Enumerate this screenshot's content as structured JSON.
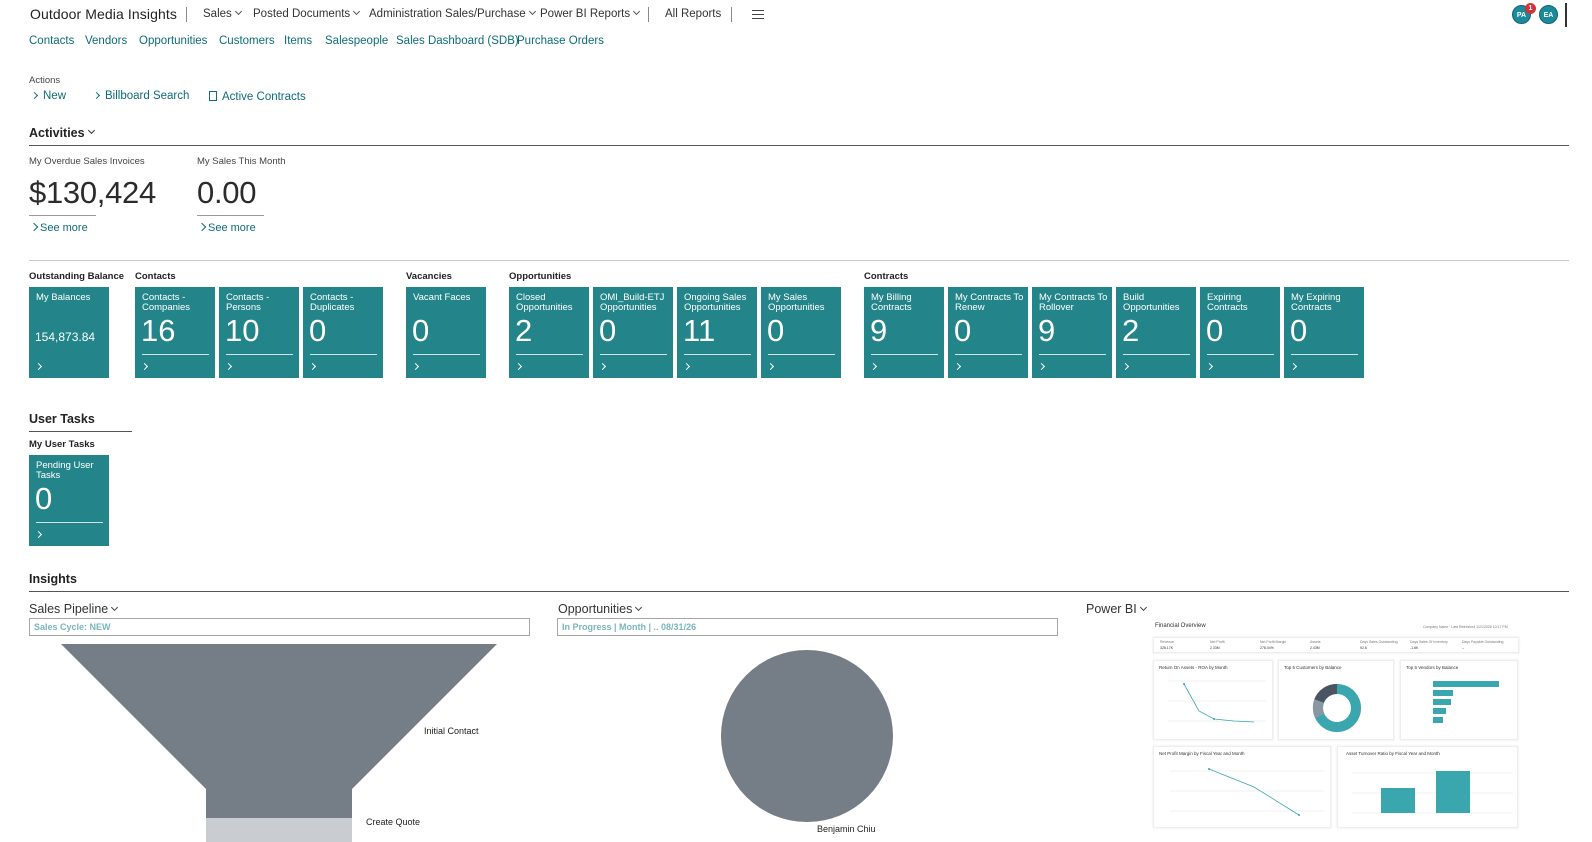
{
  "app_title": "Outdoor Media Insights",
  "topnav": {
    "items": [
      {
        "label": "Sales",
        "dropdown": true
      },
      {
        "label": "Posted Documents",
        "dropdown": true
      },
      {
        "label": "Administration Sales/Purchase",
        "dropdown": true
      },
      {
        "label": "Power BI Reports",
        "dropdown": true
      },
      {
        "label": "All Reports",
        "dropdown": false
      }
    ],
    "menu_icon": "hamburger-icon",
    "avatars": [
      {
        "initials": "PA",
        "badge": "1"
      },
      {
        "initials": "EA"
      }
    ]
  },
  "subnav": [
    "Contacts",
    "Vendors",
    "Opportunities",
    "Customers",
    "Items",
    "Salespeople",
    "Sales Dashboard (SDB)",
    "Purchase Orders"
  ],
  "actions": {
    "label": "Actions",
    "items": [
      {
        "label": "New",
        "icon": "chevron-right-icon"
      },
      {
        "label": "Billboard Search",
        "icon": "chevron-right-icon"
      },
      {
        "label": "Active Contracts",
        "icon": "document-icon"
      }
    ]
  },
  "activities": {
    "title": "Activities",
    "kpis": [
      {
        "label": "My Overdue Sales Invoices",
        "value": "$130,424",
        "link": "See more"
      },
      {
        "label": "My Sales This Month",
        "value": "0.00",
        "link": "See more"
      }
    ],
    "groups": [
      {
        "label": "Outstanding Balance",
        "tiles": [
          {
            "title": "My Balances",
            "value": "154,873.84"
          }
        ]
      },
      {
        "label": "Contacts",
        "tiles": [
          {
            "title": "Contacts - Companies",
            "value": "16"
          },
          {
            "title": "Contacts - Persons",
            "value": "10"
          },
          {
            "title": "Contacts - Duplicates",
            "value": "0"
          }
        ]
      },
      {
        "label": "Vacancies",
        "tiles": [
          {
            "title": "Vacant Faces",
            "value": "0"
          }
        ]
      },
      {
        "label": "Opportunities",
        "tiles": [
          {
            "title": "Closed Opportunities",
            "value": "2"
          },
          {
            "title": "OMI_Build-ETJ Opportunities",
            "value": "0"
          },
          {
            "title": "Ongoing Sales Opportunities",
            "value": "11"
          },
          {
            "title": "My Sales Opportunities",
            "value": "0"
          }
        ]
      },
      {
        "label": "Contracts",
        "tiles": [
          {
            "title": "My Billing Contracts",
            "value": "9"
          },
          {
            "title": "My Contracts To Renew",
            "value": "0"
          },
          {
            "title": "My Contracts To Rollover",
            "value": "9"
          },
          {
            "title": "Build Opportunities",
            "value": "2"
          },
          {
            "title": "Expiring Contracts",
            "value": "0"
          },
          {
            "title": "My Expiring Contracts",
            "value": "0"
          }
        ]
      }
    ]
  },
  "user_tasks": {
    "title": "User Tasks",
    "group_label": "My User Tasks",
    "tile": {
      "title": "Pending User Tasks",
      "value": "0"
    }
  },
  "insights": {
    "title": "Insights",
    "sales_pipeline": {
      "title": "Sales Pipeline",
      "filter": "Sales Cycle: NEW",
      "stages": [
        "Initial Contact",
        "Create Quote"
      ]
    },
    "opportunities": {
      "title": "Opportunities",
      "filter": "In Progress | Month | .. 08/31/26",
      "slice_label": "Benjamin Chiu"
    },
    "power_bi": {
      "title": "Power BI",
      "report_title": "Financial Overview",
      "header_meta": "Company Name · Last Refreshed 1/21/2026 10:17 PM",
      "kpis": [
        {
          "label": "Revenue",
          "value": "328.17K"
        },
        {
          "label": "Net Profit",
          "value": "2.33M"
        },
        {
          "label": "Net Profit Margin",
          "value": "278.04%"
        },
        {
          "label": "Assets",
          "value": "2.43M"
        },
        {
          "label": "Days Sales Outstanding",
          "value": "92.6"
        },
        {
          "label": "Days Sales Of Inventory",
          "value": "-1.6K"
        },
        {
          "label": "Days Payable Outstanding",
          "value": "--"
        }
      ],
      "visuals": [
        "Return On Assets - ROA by Month",
        "Top 5 Customers by Balance",
        "Top 5 Vendors by Balance",
        "Net Profit Margin by Fiscal Year and Month",
        "Asset Turnover Ratio by Fiscal Year and Month"
      ]
    }
  },
  "colors": {
    "tile": "#238589",
    "link": "#0e6b79",
    "chart_gray": "#757d87",
    "pbi_teal": "#3aa6ae"
  }
}
